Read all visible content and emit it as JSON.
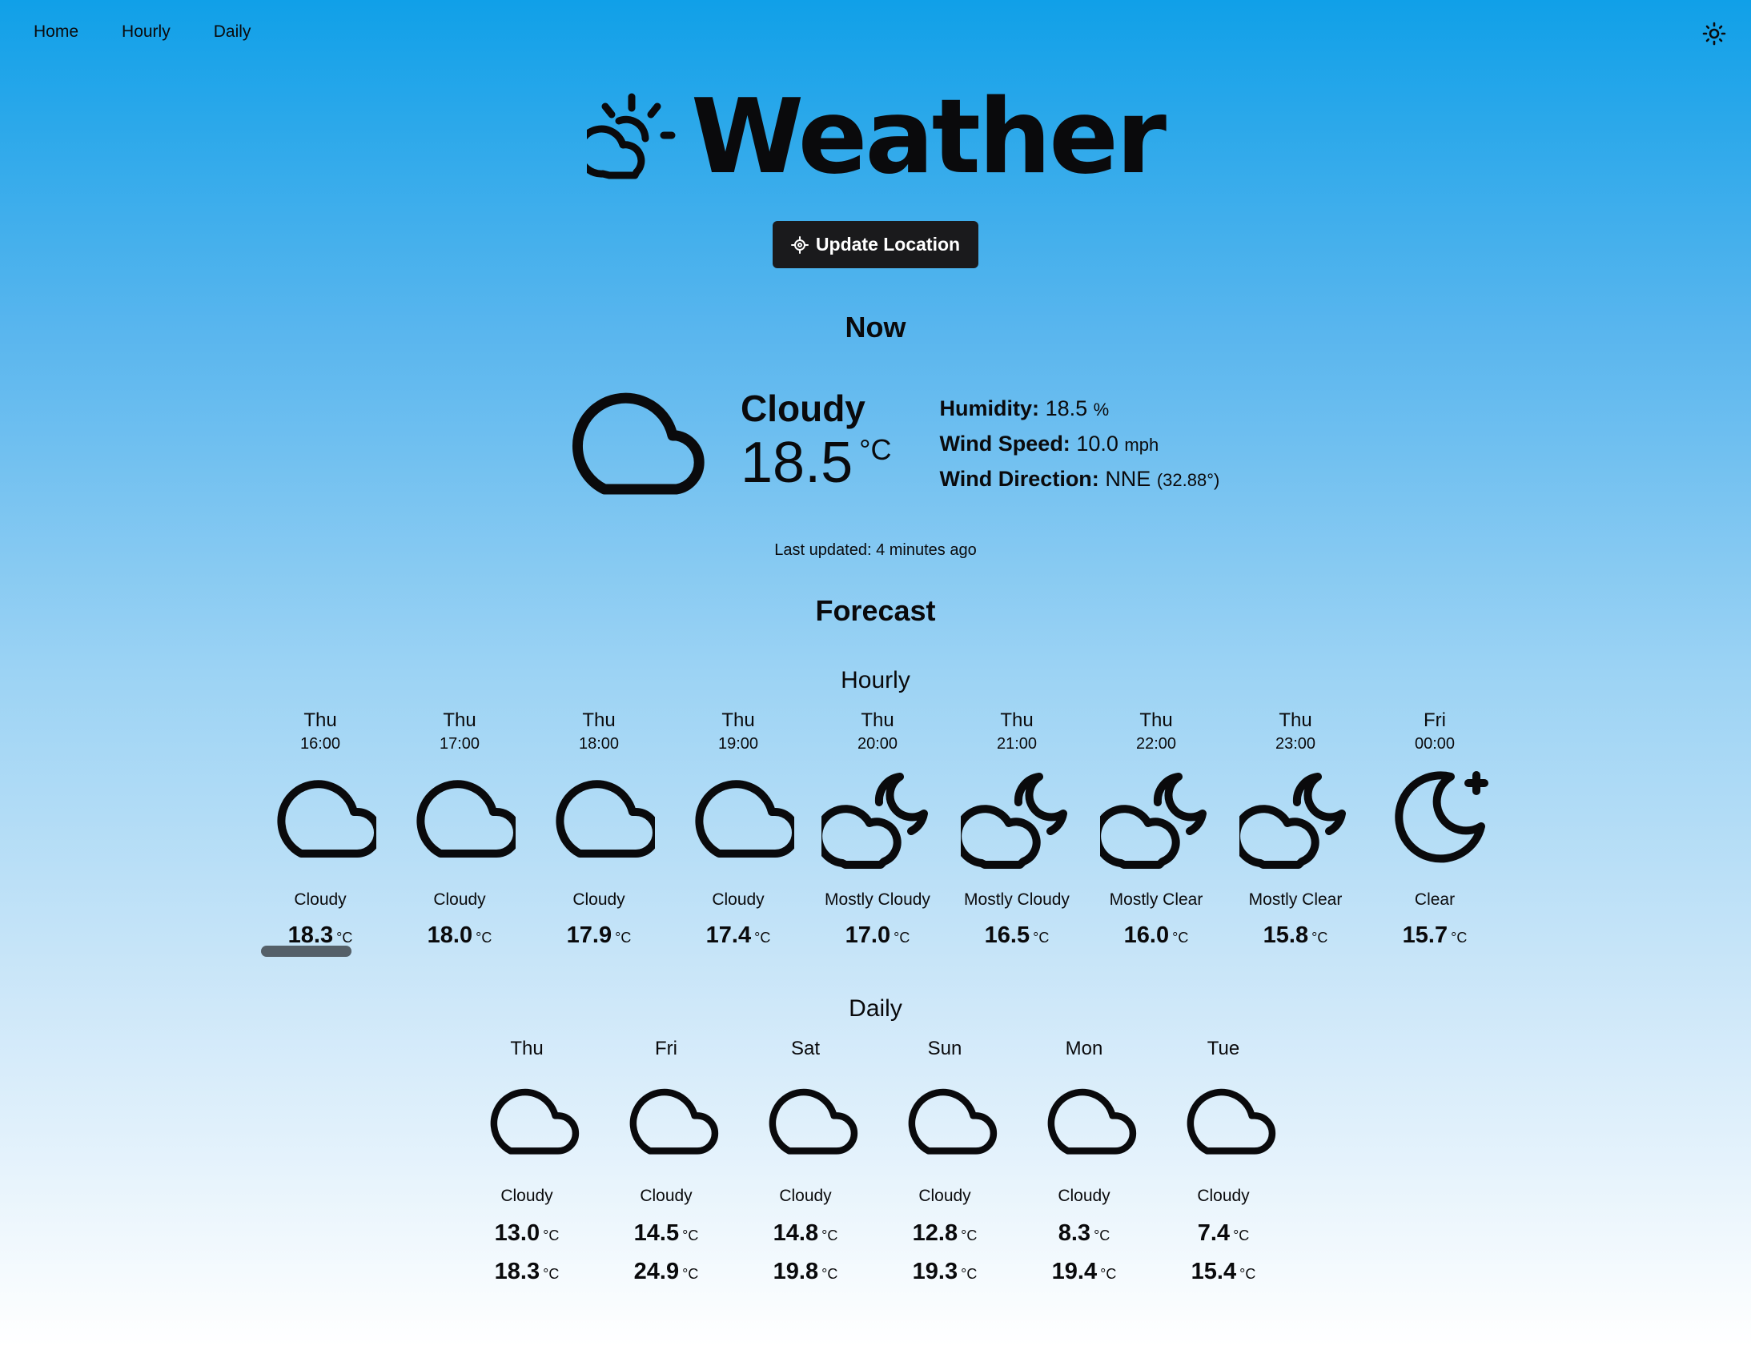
{
  "nav": {
    "items": [
      {
        "label": "Home"
      },
      {
        "label": "Hourly"
      },
      {
        "label": "Daily"
      }
    ],
    "theme_toggle_icon": "sun-icon"
  },
  "header": {
    "logo_icon": "cloud-sun-icon",
    "title": "Weather"
  },
  "update_location": {
    "icon": "crosshair-icon",
    "label": "Update Location"
  },
  "now": {
    "title": "Now",
    "icon": "cloud-icon",
    "condition": "Cloudy",
    "temperature": "18.5",
    "unit": "°C",
    "humidity_label": "Humidity:",
    "humidity_value": "18.5",
    "humidity_unit": "%",
    "wind_speed_label": "Wind Speed:",
    "wind_speed_value": "10.0",
    "wind_speed_unit": "mph",
    "wind_direction_label": "Wind Direction:",
    "wind_direction_value": "NNE",
    "wind_direction_degrees": "(32.88°)",
    "last_updated": "Last updated: 4 minutes ago"
  },
  "forecast": {
    "title": "Forecast",
    "hourly_title": "Hourly",
    "daily_title": "Daily",
    "unit": "°C",
    "hourly": [
      {
        "day": "Thu",
        "time": "16:00",
        "icon": "cloud-icon",
        "condition": "Cloudy",
        "temp": "18.3"
      },
      {
        "day": "Thu",
        "time": "17:00",
        "icon": "cloud-icon",
        "condition": "Cloudy",
        "temp": "18.0"
      },
      {
        "day": "Thu",
        "time": "18:00",
        "icon": "cloud-icon",
        "condition": "Cloudy",
        "temp": "17.9"
      },
      {
        "day": "Thu",
        "time": "19:00",
        "icon": "cloud-icon",
        "condition": "Cloudy",
        "temp": "17.4"
      },
      {
        "day": "Thu",
        "time": "20:00",
        "icon": "cloud-moon-icon",
        "condition": "Mostly Cloudy",
        "temp": "17.0"
      },
      {
        "day": "Thu",
        "time": "21:00",
        "icon": "cloud-moon-icon",
        "condition": "Mostly Cloudy",
        "temp": "16.5"
      },
      {
        "day": "Thu",
        "time": "22:00",
        "icon": "cloud-moon-icon",
        "condition": "Mostly Clear",
        "temp": "16.0"
      },
      {
        "day": "Thu",
        "time": "23:00",
        "icon": "cloud-moon-icon",
        "condition": "Mostly Clear",
        "temp": "15.8"
      },
      {
        "day": "Fri",
        "time": "00:00",
        "icon": "moon-star-icon",
        "condition": "Clear",
        "temp": "15.7"
      }
    ],
    "daily": [
      {
        "day": "Thu",
        "icon": "cloud-icon",
        "condition": "Cloudy",
        "temp_low": "13.0",
        "temp_high": "18.3"
      },
      {
        "day": "Fri",
        "icon": "cloud-icon",
        "condition": "Cloudy",
        "temp_low": "14.5",
        "temp_high": "24.9"
      },
      {
        "day": "Sat",
        "icon": "cloud-icon",
        "condition": "Cloudy",
        "temp_low": "14.8",
        "temp_high": "19.8"
      },
      {
        "day": "Sun",
        "icon": "cloud-icon",
        "condition": "Cloudy",
        "temp_low": "12.8",
        "temp_high": "19.3"
      },
      {
        "day": "Mon",
        "icon": "cloud-icon",
        "condition": "Cloudy",
        "temp_low": "8.3",
        "temp_high": "19.4"
      },
      {
        "day": "Tue",
        "icon": "cloud-icon",
        "condition": "Cloudy",
        "temp_low": "7.4",
        "temp_high": "15.4"
      }
    ]
  }
}
